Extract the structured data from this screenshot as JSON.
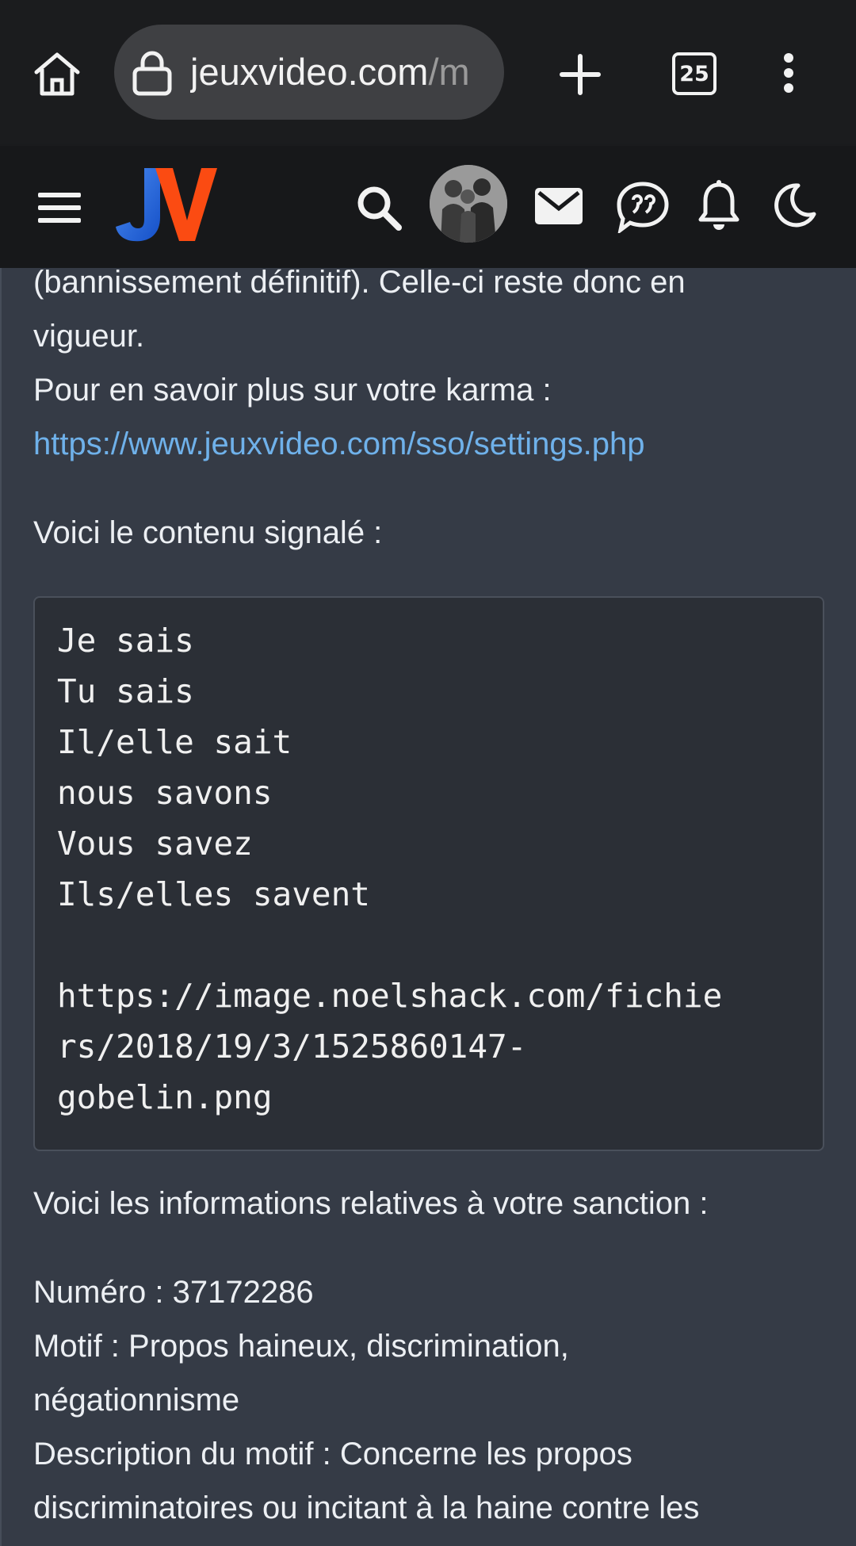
{
  "browser": {
    "url_host": "jeuxvideo.com",
    "url_rest": "/m",
    "tab_count": "25"
  },
  "content": {
    "line1": "(bannissement définitif). Celle-ci reste donc en",
    "line2": "vigueur.",
    "line3": "Pour en savoir plus sur votre karma :",
    "karma_link": "https://www.jeuxvideo.com/sso/settings.php",
    "reported_intro": "Voici le contenu signalé :",
    "code_lines": [
      "Je sais",
      "Tu sais",
      "Il/elle sait",
      "nous savons",
      "Vous savez",
      "Ils/elles savent",
      "",
      "https://image.noelshack.com/fichie",
      "rs/2018/19/3/1525860147-",
      "gobelin.png"
    ],
    "sanction_intro": "Voici les informations relatives à votre sanction :",
    "numero": "Numéro : 37172286",
    "motif_1": "Motif : Propos haineux, discrimination,",
    "motif_2": "négationnisme",
    "desc_1": "Description du motif : Concerne les propos",
    "desc_2": "discriminatoires ou incitant à la haine contre les"
  },
  "colors": {
    "chrome_bg": "#1b1c1e",
    "header_bg": "#17181a",
    "content_bg": "#353b46",
    "link": "#6fb1ea",
    "logo_blue": "#1e73e8",
    "logo_orange": "#fb4b12"
  }
}
